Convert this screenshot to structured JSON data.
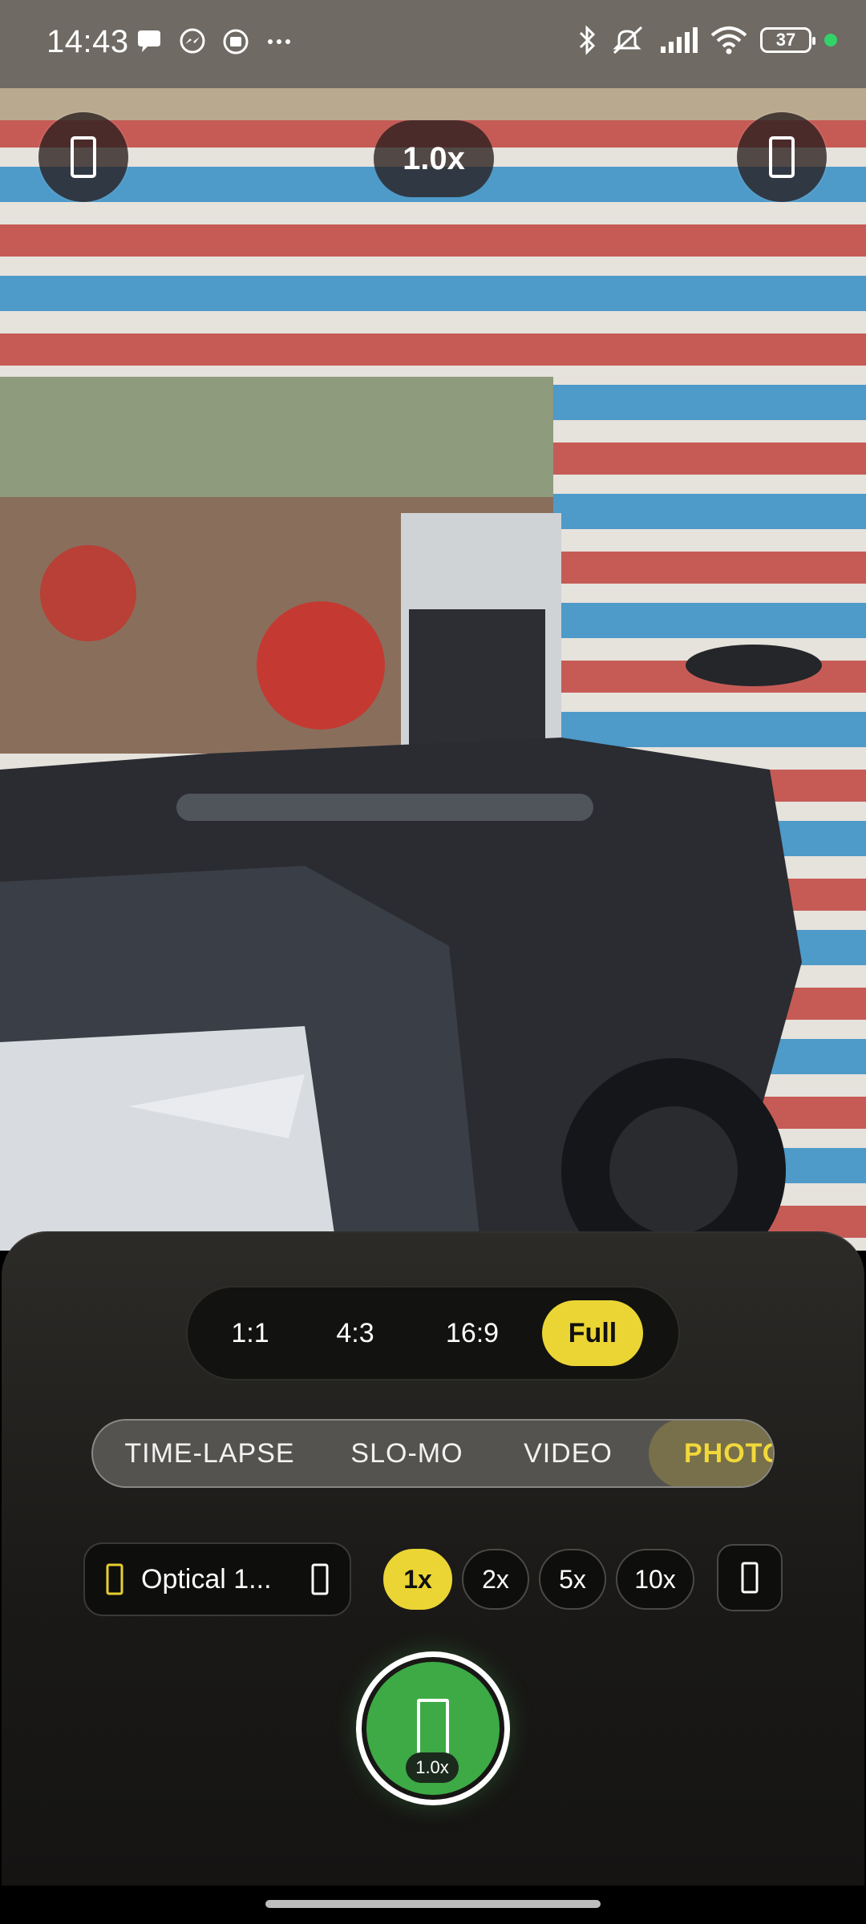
{
  "status_bar": {
    "time": "14:43",
    "left_icons": [
      "chat-bubble-icon",
      "messenger-icon",
      "app-notification-icon",
      "more-dots-icon"
    ],
    "right_icons": [
      "bluetooth-icon",
      "silent-vibrate-icon",
      "signal-icon",
      "wifi-icon"
    ],
    "battery_level": "37",
    "privacy_dot_color": "#33d36a"
  },
  "top_controls": {
    "left_button_icon": "flash-icon",
    "zoom_indicator": "1.0x",
    "right_button_icon": "switch-camera-icon"
  },
  "aspect_ratios": {
    "options": [
      "1:1",
      "4:3",
      "16:9",
      "Full"
    ],
    "selected": "Full"
  },
  "modes": {
    "options": [
      "TIME-LAPSE",
      "SLO-MO",
      "VIDEO",
      "PHOTO"
    ],
    "selected": "PHOTO"
  },
  "lens": {
    "icon": "lens-icon",
    "label": "Optical 1...",
    "chevron_icon": "chevron-down-icon"
  },
  "zoom_levels": {
    "options": [
      "1x",
      "2x",
      "5x",
      "10x"
    ],
    "selected": "1x"
  },
  "settings_icon": "settings-icon",
  "shutter": {
    "icon": "phone-frame-icon",
    "zoom_badge": "1.0x",
    "color": "#3daa45"
  },
  "accent_color": "#ebd534"
}
